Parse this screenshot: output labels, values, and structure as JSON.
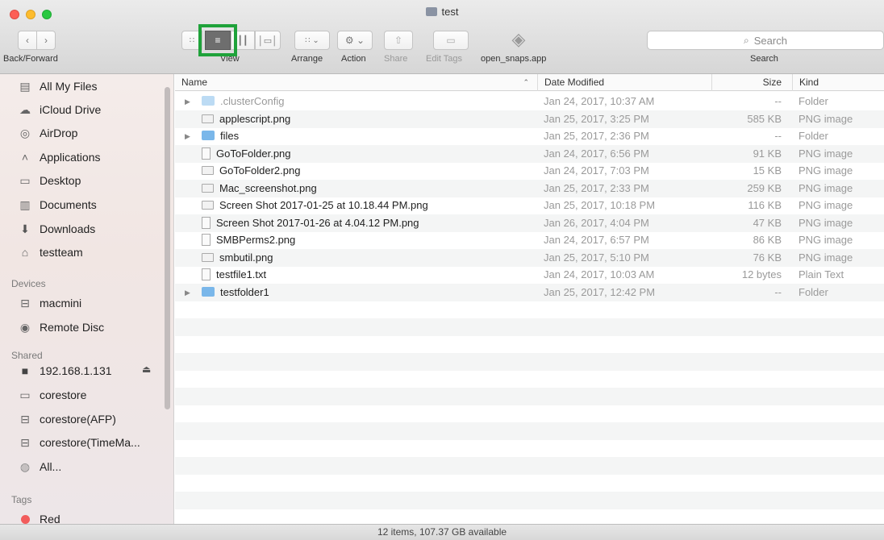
{
  "window": {
    "title": "test"
  },
  "toolbar": {
    "back_forward_label": "Back/Forward",
    "view_label": "View",
    "arrange_label": "Arrange",
    "action_label": "Action",
    "share_label": "Share",
    "edit_tags_label": "Edit Tags",
    "app_label": "open_snaps.app",
    "search_label": "Search",
    "search_placeholder": "Search"
  },
  "sidebar": {
    "favorites": [
      {
        "label": "All My Files",
        "icon": "all-files-icon"
      },
      {
        "label": "iCloud Drive",
        "icon": "cloud-icon"
      },
      {
        "label": "AirDrop",
        "icon": "airdrop-icon"
      },
      {
        "label": "Applications",
        "icon": "applications-icon"
      },
      {
        "label": "Desktop",
        "icon": "desktop-icon"
      },
      {
        "label": "Documents",
        "icon": "documents-icon"
      },
      {
        "label": "Downloads",
        "icon": "downloads-icon"
      },
      {
        "label": "testteam",
        "icon": "home-icon"
      }
    ],
    "devices_heading": "Devices",
    "devices": [
      {
        "label": "macmini",
        "icon": "hard-drive-icon"
      },
      {
        "label": "Remote Disc",
        "icon": "disc-icon"
      }
    ],
    "shared_heading": "Shared",
    "shared": [
      {
        "label": "192.168.1.131",
        "icon": "monitor-icon"
      },
      {
        "label": "corestore",
        "icon": "display-icon"
      },
      {
        "label": "corestore(AFP)",
        "icon": "server-icon"
      },
      {
        "label": "corestore(TimeMa...",
        "icon": "server-icon"
      },
      {
        "label": "All...",
        "icon": "network-globe-icon"
      }
    ],
    "tags_heading": "Tags",
    "tags": [
      {
        "label": "Red",
        "color": "#f25c5c"
      }
    ]
  },
  "columns": {
    "name": "Name",
    "date": "Date Modified",
    "size": "Size",
    "kind": "Kind"
  },
  "files": [
    {
      "name": ".clusterConfig",
      "date": "Jan 24, 2017, 10:37 AM",
      "size": "--",
      "kind": "Folder",
      "type": "folder",
      "dim": true
    },
    {
      "name": "applescript.png",
      "date": "Jan 25, 2017, 3:25 PM",
      "size": "585 KB",
      "kind": "PNG image",
      "type": "image"
    },
    {
      "name": "files",
      "date": "Jan 25, 2017, 2:36 PM",
      "size": "--",
      "kind": "Folder",
      "type": "folder"
    },
    {
      "name": "GoToFolder.png",
      "date": "Jan 24, 2017, 6:56 PM",
      "size": "91 KB",
      "kind": "PNG image",
      "type": "doc"
    },
    {
      "name": "GoToFolder2.png",
      "date": "Jan 24, 2017, 7:03 PM",
      "size": "15 KB",
      "kind": "PNG image",
      "type": "image"
    },
    {
      "name": "Mac_screenshot.png",
      "date": "Jan 25, 2017, 2:33 PM",
      "size": "259 KB",
      "kind": "PNG image",
      "type": "image"
    },
    {
      "name": "Screen Shot 2017-01-25 at 10.18.44 PM.png",
      "date": "Jan 25, 2017, 10:18 PM",
      "size": "116 KB",
      "kind": "PNG image",
      "type": "image"
    },
    {
      "name": "Screen Shot 2017-01-26 at 4.04.12 PM.png",
      "date": "Jan 26, 2017, 4:04 PM",
      "size": "47 KB",
      "kind": "PNG image",
      "type": "doc"
    },
    {
      "name": "SMBPerms2.png",
      "date": "Jan 24, 2017, 6:57 PM",
      "size": "86 KB",
      "kind": "PNG image",
      "type": "doc"
    },
    {
      "name": "smbutil.png",
      "date": "Jan 25, 2017, 5:10 PM",
      "size": "76 KB",
      "kind": "PNG image",
      "type": "image"
    },
    {
      "name": "testfile1.txt",
      "date": "Jan 24, 2017, 10:03 AM",
      "size": "12 bytes",
      "kind": "Plain Text",
      "type": "doc"
    },
    {
      "name": "testfolder1",
      "date": "Jan 25, 2017, 12:42 PM",
      "size": "--",
      "kind": "Folder",
      "type": "folder"
    }
  ],
  "status": {
    "text": "12 items, 107.37 GB available"
  }
}
